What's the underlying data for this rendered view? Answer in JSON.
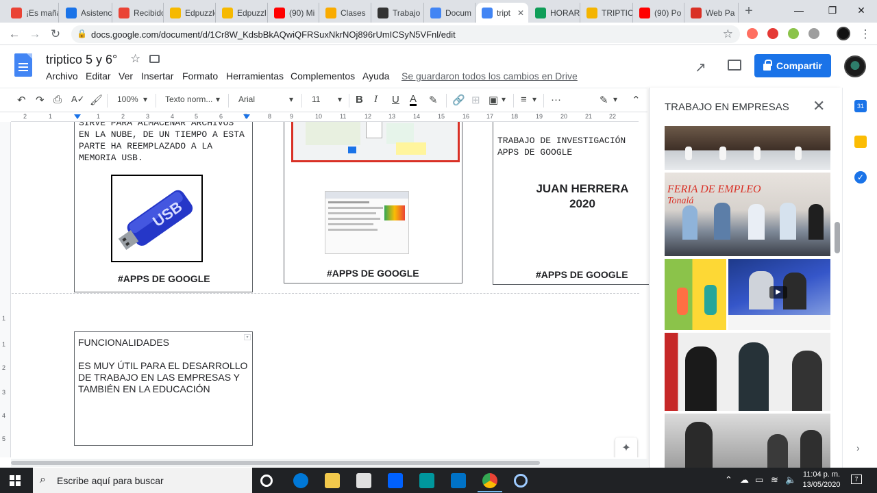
{
  "browser": {
    "tabs": [
      {
        "label": "¡Es maña",
        "icon": "gmail-icon",
        "color": "#ea4335"
      },
      {
        "label": "Asistenc",
        "icon": "meet-icon",
        "color": "#1a73e8"
      },
      {
        "label": "Recibido",
        "icon": "gmail-icon",
        "color": "#ea4335"
      },
      {
        "label": "Edpuzzle",
        "icon": "edpuzzle-icon",
        "color": "#f6b900"
      },
      {
        "label": "Edpuzzl",
        "icon": "edpuzzle-icon",
        "color": "#f6b900"
      },
      {
        "label": "(90) Mi",
        "icon": "youtube-icon",
        "color": "#ff0000"
      },
      {
        "label": "Clases",
        "icon": "classroom-icon",
        "color": "#f9ab00"
      },
      {
        "label": "Trabajo",
        "icon": "classroom-icon",
        "color": "#333333"
      },
      {
        "label": "Docum",
        "icon": "docs-icon",
        "color": "#4285f4"
      },
      {
        "label": "tript",
        "icon": "docs-icon",
        "color": "#4285f4",
        "active": true
      },
      {
        "label": "HORAR",
        "icon": "drive-icon",
        "color": "#0f9d58"
      },
      {
        "label": "TRIPTIC",
        "icon": "slides-icon",
        "color": "#f4b400"
      },
      {
        "label": "(90) Po",
        "icon": "youtube-icon",
        "color": "#ff0000"
      },
      {
        "label": "Web Pa",
        "icon": "web-icon",
        "color": "#d93025"
      }
    ],
    "url": "docs.google.com/document/d/1Cr8W_KdsbBkAQwiQFRSuxNkrNOj896rUmICSyN5VFnl/edit"
  },
  "docs": {
    "title": "triptico 5 y 6°",
    "menu": [
      "Archivo",
      "Editar",
      "Ver",
      "Insertar",
      "Formato",
      "Herramientas",
      "Complementos",
      "Ayuda"
    ],
    "save_status": "Se guardaron todos los cambios en Drive",
    "share_label": "Compartir"
  },
  "toolbar": {
    "zoom": "100%",
    "style": "Texto norm...",
    "font": "Arial",
    "size": "11"
  },
  "ruler": {
    "labels": [
      "2",
      "1",
      "1",
      "2",
      "3",
      "4",
      "5",
      "6",
      "7",
      "8",
      "9",
      "10",
      "11",
      "12",
      "13",
      "14",
      "15",
      "16",
      "17",
      "18",
      "19",
      "20",
      "21",
      "22"
    ]
  },
  "document": {
    "col1_text": "SIRVE PARA ALMACENAR ARCHIVOS EN LA NUBE, DE UN TIEMPO A ESTA PARTE HA REEMPLAZADO A LA MEMORIA USB.",
    "usb_label": "USB",
    "hashtag1": "#APPS DE GOOGLE",
    "hashtag2": "#APPS DE GOOGLE",
    "hashtag3": "#APPS DE GOOGLE",
    "col3_text": "TRABAJO DE INVESTIGACIÓN APPS DE GOOGLE",
    "author": "JUAN HERRERA",
    "year": "2020",
    "funcionalidades_title": "FUNCIONALIDADES",
    "funcionalidades_body": "ES MUY ÚTIL PARA EL DESARROLLO DE TRABAJO EN LAS EMPRESAS Y TAMBIÉN EN LA EDUCACIÓN"
  },
  "sidepanel": {
    "title": "TRABAJO EN EMPRESAS",
    "banner_text": "FERIA DE EMPLEO",
    "banner_sub": "Tonalá"
  },
  "taskbar": {
    "search_placeholder": "Escribe aquí para buscar",
    "time": "11:04 p. m.",
    "date": "13/05/2020"
  }
}
